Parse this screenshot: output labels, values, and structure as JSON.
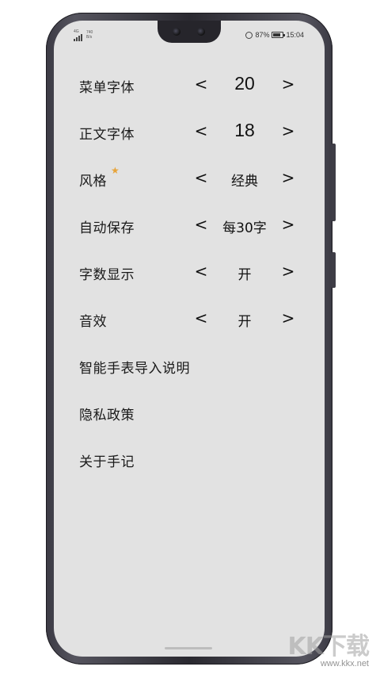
{
  "status_bar": {
    "network": "4G",
    "speed_value": "740",
    "speed_unit": "B/s",
    "battery": "87%",
    "time": "15:04"
  },
  "settings": {
    "menu_font": {
      "label": "菜单字体",
      "value": "20",
      "prev": "<",
      "next": ">"
    },
    "body_font": {
      "label": "正文字体",
      "value": "18",
      "prev": "<",
      "next": ">"
    },
    "style": {
      "label": "风格",
      "star": "★",
      "value": "经典",
      "prev": "<",
      "next": ">"
    },
    "auto_save": {
      "label": "自动保存",
      "value": "每30字",
      "prev": "<",
      "next": ">"
    },
    "word_count": {
      "label": "字数显示",
      "value": "开",
      "prev": "<",
      "next": ">"
    },
    "sound": {
      "label": "音效",
      "value": "开",
      "prev": "<",
      "next": ">"
    }
  },
  "links": {
    "watch_import": "智能手表导入说明",
    "privacy": "隐私政策",
    "about": "关于手记"
  },
  "watermark": {
    "brand": "KK下载",
    "url": "www.kkx.net"
  },
  "colors": {
    "screen_bg": "#e2e2e2",
    "star": "#e7a43a",
    "frame": "#2a2930"
  }
}
